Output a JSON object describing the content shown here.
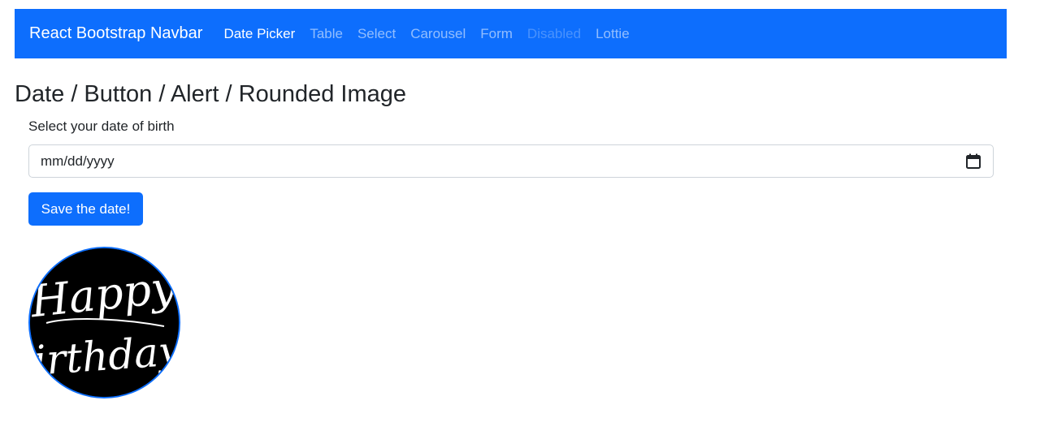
{
  "navbar": {
    "brand": "React Bootstrap Navbar",
    "links": [
      {
        "label": "Date Picker",
        "state": "active"
      },
      {
        "label": "Table",
        "state": "normal"
      },
      {
        "label": "Select",
        "state": "normal"
      },
      {
        "label": "Carousel",
        "state": "normal"
      },
      {
        "label": "Form",
        "state": "normal"
      },
      {
        "label": "Disabled",
        "state": "disabled"
      },
      {
        "label": "Lottie",
        "state": "normal"
      }
    ]
  },
  "main": {
    "title": "Date / Button / Alert / Rounded Image",
    "date_label": "Select your date of birth",
    "date_placeholder": "mm/dd/yyyy",
    "save_button": "Save the date!",
    "image": {
      "line1": "Happy",
      "line2": "Birthday!"
    }
  },
  "colors": {
    "primary": "#0d6efd",
    "text": "#212529",
    "border": "#ced4da"
  },
  "icons": {
    "date_picker": "calendar-icon"
  }
}
